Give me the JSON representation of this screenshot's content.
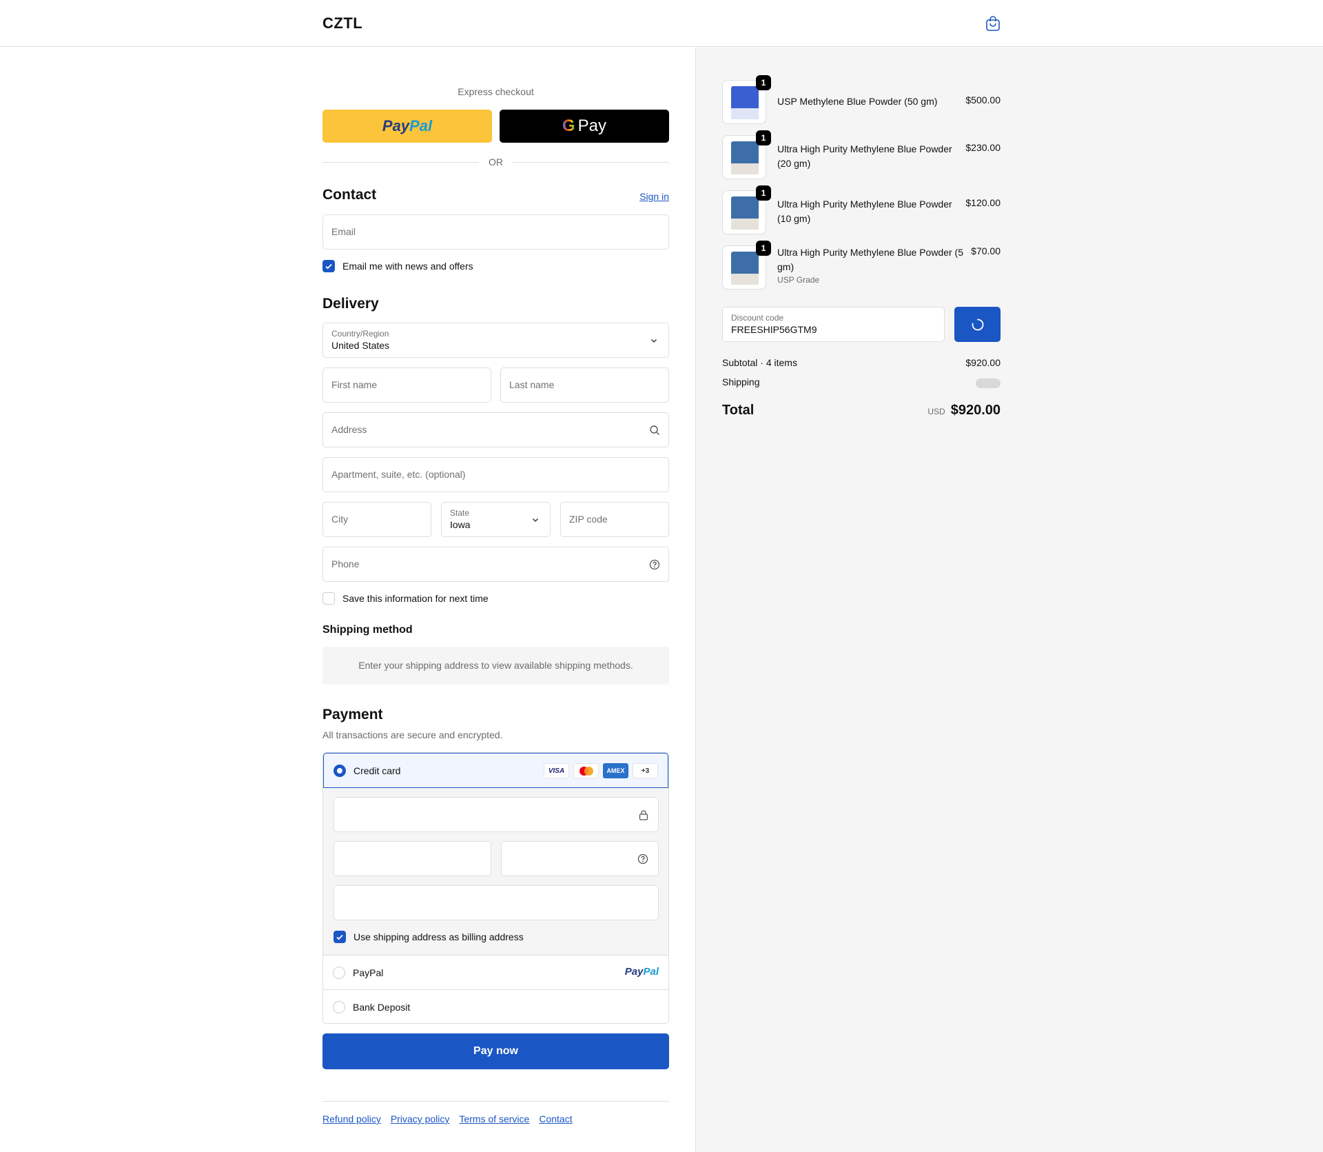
{
  "header": {
    "logo": "CZTL",
    "cart_icon": "shopping-bag-icon"
  },
  "express": {
    "label": "Express checkout",
    "paypal_pay": "Pay",
    "paypal_pal": "Pal",
    "gpay_g": "G",
    "gpay_label": "Pay",
    "or": "OR"
  },
  "contact": {
    "title": "Contact",
    "signin": "Sign in",
    "email_placeholder": "Email",
    "news_label": "Email me with news and offers",
    "news_checked": true
  },
  "delivery": {
    "title": "Delivery",
    "country_label": "Country/Region",
    "country_value": "United States",
    "first_name": "First name",
    "last_name": "Last name",
    "address": "Address",
    "apartment": "Apartment, suite, etc. (optional)",
    "city": "City",
    "state_label": "State",
    "state_value": "Iowa",
    "zip": "ZIP code",
    "phone": "Phone",
    "save_label": "Save this information for next time",
    "save_checked": false
  },
  "shipping": {
    "title": "Shipping method",
    "message": "Enter your shipping address to view available shipping methods."
  },
  "payment": {
    "title": "Payment",
    "subtitle": "All transactions are secure and encrypted.",
    "credit_card": "Credit card",
    "cards": [
      "VISA",
      "MC",
      "AMEX",
      "+3"
    ],
    "billing_label": "Use shipping address as billing address",
    "billing_checked": true,
    "paypal_option": "PayPal",
    "paypal_logo_pay": "Pay",
    "paypal_logo_pal": "Pal",
    "bank_option": "Bank Deposit",
    "pay_now": "Pay now"
  },
  "footer": {
    "links": [
      "Refund policy",
      "Privacy policy",
      "Terms of service",
      "Contact"
    ]
  },
  "summary": {
    "items": [
      {
        "name": "USP Methylene Blue Powder (50 gm)",
        "price": "$500.00",
        "qty": "1",
        "variant": ""
      },
      {
        "name": "Ultra High Purity Methylene Blue Powder (20 gm)",
        "price": "$230.00",
        "qty": "1",
        "variant": ""
      },
      {
        "name": "Ultra High Purity Methylene Blue Powder (10 gm)",
        "price": "$120.00",
        "qty": "1",
        "variant": ""
      },
      {
        "name": "Ultra High Purity Methylene Blue Powder (5 gm)",
        "price": "$70.00",
        "qty": "1",
        "variant": "USP Grade"
      }
    ],
    "discount_label": "Discount code",
    "discount_value": "FREESHIP56GTM9",
    "subtotal_label": "Subtotal · 4 items",
    "subtotal_value": "$920.00",
    "shipping_label": "Shipping",
    "total_label": "Total",
    "currency": "USD",
    "total_value": "$920.00"
  },
  "colors": {
    "accent": "#1a56c4",
    "paypal_yellow": "#fbc43a"
  }
}
